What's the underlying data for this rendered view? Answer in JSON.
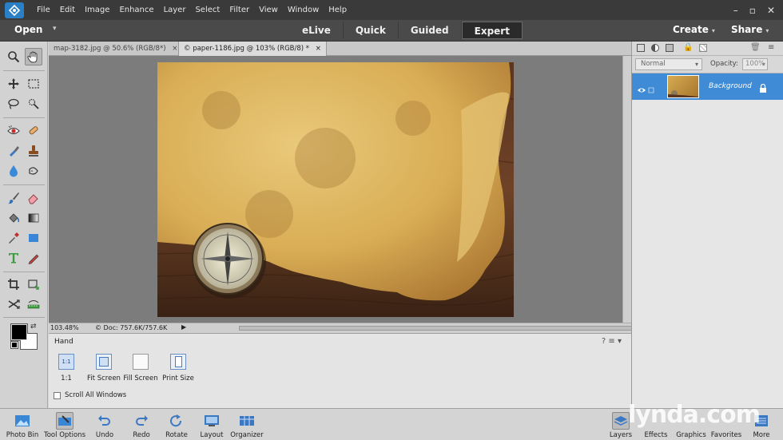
{
  "menu": [
    "File",
    "Edit",
    "Image",
    "Enhance",
    "Layer",
    "Select",
    "Filter",
    "View",
    "Window",
    "Help"
  ],
  "modebar": {
    "open": "Open",
    "modes": [
      "eLive",
      "Quick",
      "Guided",
      "Expert"
    ],
    "active_mode": "Expert",
    "create": "Create",
    "share": "Share"
  },
  "tabs": [
    {
      "label": "map-3182.jpg @ 50.6% (RGB/8*)",
      "active": false
    },
    {
      "label": "© paper-1186.jpg @ 103% (RGB/8) *",
      "active": true
    }
  ],
  "status": {
    "zoom": "103.48%",
    "doc": "© Doc: 757.6K/757.6K"
  },
  "tool_options": {
    "title": "Hand",
    "options": [
      {
        "label": "1:1",
        "icon_text": "1:1"
      },
      {
        "label": "Fit Screen"
      },
      {
        "label": "Fill Screen"
      },
      {
        "label": "Print Size"
      }
    ],
    "checkbox": "Scroll All Windows"
  },
  "layers": {
    "blend_mode": "Normal",
    "opacity_label": "Opacity:",
    "opacity_value": "100%",
    "layer_name": "Background"
  },
  "taskbar": {
    "left": [
      "Photo Bin",
      "Tool Options",
      "Undo",
      "Redo",
      "Rotate",
      "Layout",
      "Organizer"
    ],
    "right": [
      "Layers",
      "Effects",
      "Graphics",
      "Favorites",
      "More"
    ]
  },
  "watermark": "lynda.com",
  "colors": {
    "accent": "#3f8bd5",
    "menubar": "#3a3a3a",
    "modebar": "#4a4a4a"
  }
}
